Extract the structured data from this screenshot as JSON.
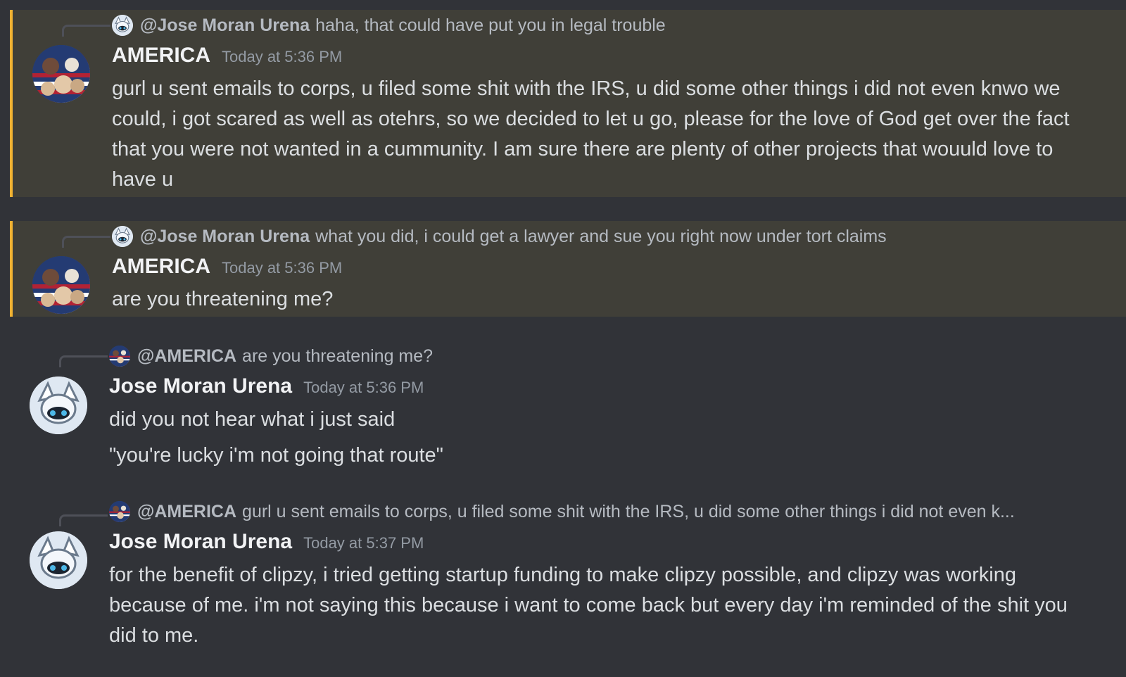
{
  "messages": [
    {
      "reply": {
        "user": "@Jose Moran Urena",
        "text": "haha, that could have put you in legal trouble",
        "avatar": "fox-avatar"
      },
      "author": "AMERICA",
      "timestamp": "Today at 5:36 PM",
      "avatar": "america-collage-avatar",
      "lines": [
        "gurl u sent emails to corps, u filed some shit with the IRS, u did some other things i did not even knwo we could, i got scared as well as otehrs, so we decided to let u go, please for the love of God get over the fact that you were not wanted in a cummunity. I am sure there are plenty of other projects that wouuld love to have u"
      ],
      "highlighted": true
    },
    {
      "reply": {
        "user": "@Jose Moran Urena",
        "text": "what you did, i could get a lawyer and sue you right now under tort claims",
        "avatar": "fox-avatar"
      },
      "author": "AMERICA",
      "timestamp": "Today at 5:36 PM",
      "avatar": "america-collage-avatar",
      "lines": [
        "are you threatening me?"
      ],
      "highlighted": true
    },
    {
      "reply": {
        "user": "@AMERICA",
        "text": "are you threatening me?",
        "avatar": "america-collage-avatar"
      },
      "author": "Jose Moran Urena",
      "timestamp": "Today at 5:36 PM",
      "avatar": "fox-avatar",
      "lines": [
        "did you not hear what i just said",
        "\"you're lucky i'm not going that route\""
      ],
      "highlighted": false
    },
    {
      "reply": {
        "user": "@AMERICA",
        "text": "gurl u sent emails to corps, u filed some shit with the IRS, u did some other things i did not even k...",
        "avatar": "america-collage-avatar"
      },
      "author": "Jose Moran Urena",
      "timestamp": "Today at 5:37 PM",
      "avatar": "fox-avatar",
      "lines": [
        "for the benefit of clipzy, i tried getting startup funding to make clipzy possible, and clipzy was working because of me. i'm not saying this because i want to come back but every day i'm reminded of the shit you did to me."
      ],
      "highlighted": false
    }
  ],
  "colors": {
    "background": "#313338",
    "highlight_bg": "#403f38",
    "highlight_border": "#f0b232",
    "username": "#f2f3f5",
    "timestamp": "#949ba4",
    "reply_text": "#b5bac1"
  }
}
